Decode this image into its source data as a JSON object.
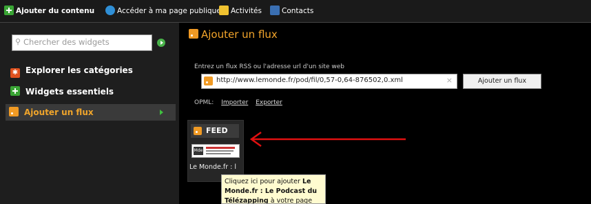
{
  "topbar": {
    "tabs": [
      {
        "label": "Ajouter du contenu",
        "icon": "add-icon"
      },
      {
        "label": "Accéder à ma page publique",
        "icon": "globe-icon"
      },
      {
        "label": "Activités",
        "icon": "star-icon"
      },
      {
        "label": "Contacts",
        "icon": "contacts-icon"
      }
    ]
  },
  "sidebar": {
    "search_placeholder": "Chercher des widgets",
    "items": [
      {
        "label": "Explorer les catégories",
        "icon": "categories-icon"
      },
      {
        "label": "Widgets essentiels",
        "icon": "add-icon"
      },
      {
        "label": "Ajouter un flux",
        "icon": "rss-icon"
      }
    ]
  },
  "main": {
    "title": "Ajouter un flux",
    "instruction": "Entrez un flux RSS ou l'adresse url d'un site web",
    "url_value": "http://www.lemonde.fr/pod/fil/0,57-0,64-876502,0.xml",
    "clear_symbol": "×",
    "add_button": "Ajouter un flux",
    "opml_label": "OPML:",
    "import_link": "Importer",
    "export_link": "Exporter",
    "feed_card": {
      "badge": "FEED",
      "label": "Le Monde.fr : l",
      "thumb_logo": "Mde"
    },
    "tooltip": {
      "prefix": "Cliquez ici pour ajouter",
      "bold": "Le Monde.fr : Le Podcast du Télézapping",
      "suffix": "à votre page"
    }
  },
  "colors": {
    "accent": "#f3a52b",
    "rss": "#f09a24",
    "green": "#3aa535",
    "arrow": "#e01010"
  }
}
